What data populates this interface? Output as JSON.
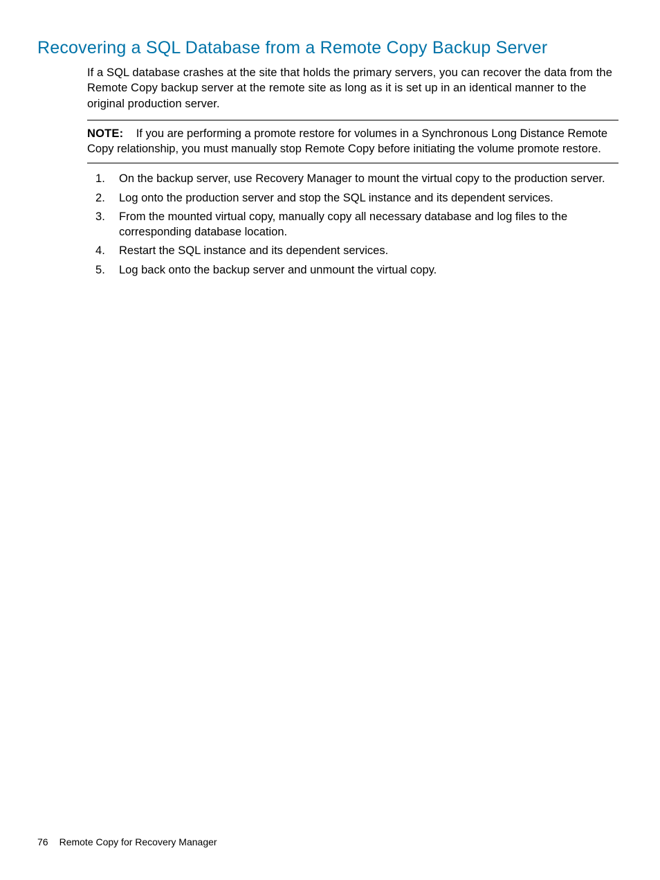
{
  "heading": "Recovering a SQL Database from a Remote Copy Backup Server",
  "intro": "If a SQL database crashes at the site that holds the primary servers, you can recover the data from the Remote Copy backup server at the remote site as long as it is set up in an identical manner to the original production server.",
  "note": {
    "label": "NOTE:",
    "text": "If you are performing a promote restore for volumes in a Synchronous Long Distance Remote Copy relationship, you must manually stop Remote Copy before initiating the volume promote restore."
  },
  "steps": [
    "On the backup server, use Recovery Manager to mount the virtual copy to the production server.",
    "Log onto the production server and stop the SQL instance and its dependent services.",
    "From the mounted virtual copy, manually copy all necessary database and log files to the corresponding database location.",
    "Restart the SQL instance and its dependent services.",
    "Log back onto the backup server and unmount the virtual copy."
  ],
  "footer": {
    "pageNumber": "76",
    "section": "Remote Copy for Recovery Manager"
  }
}
